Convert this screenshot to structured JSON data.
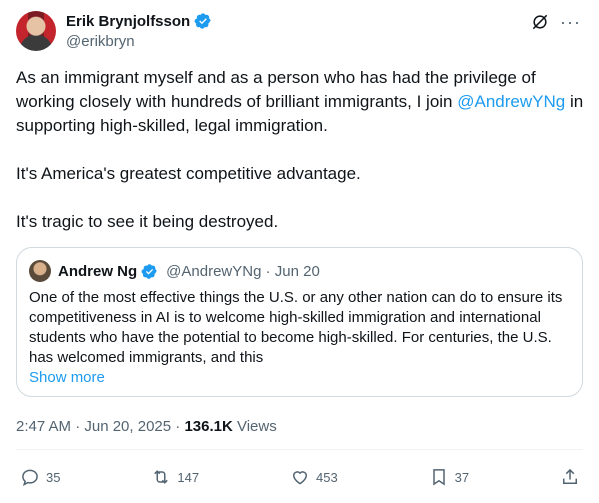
{
  "author": {
    "name": "Erik Brynjolfsson",
    "handle": "@erikbryn"
  },
  "tweet": {
    "line1_pre": "As an immigrant myself and as a person who has had the privilege of working closely with hundreds of brilliant immigrants, I join ",
    "mention": "@AndrewYNg",
    "line1_post": " in supporting high-skilled, legal immigration.",
    "para2": "It's America's greatest competitive advantage.",
    "para3": "It's tragic to see it being destroyed."
  },
  "quote": {
    "name": "Andrew Ng",
    "meta": "@AndrewYNg · Jun 20",
    "text": "One of the most effective things the U.S. or any other nation can do to ensure its competitiveness in AI is to welcome high-skilled immigration and international students who have the potential to become high-skilled. For centuries, the U.S. has welcomed immigrants, and this",
    "show_more": "Show more"
  },
  "meta": {
    "time": "2:47 AM · Jun 20, 2025 · ",
    "views_count": "136.1K",
    "views_label": " Views"
  },
  "actions": {
    "replies": "35",
    "reposts": "147",
    "likes": "453",
    "bookmarks": "37"
  },
  "colors": {
    "accent": "#1d9bf0",
    "muted": "#536471",
    "text": "#0f1419"
  }
}
